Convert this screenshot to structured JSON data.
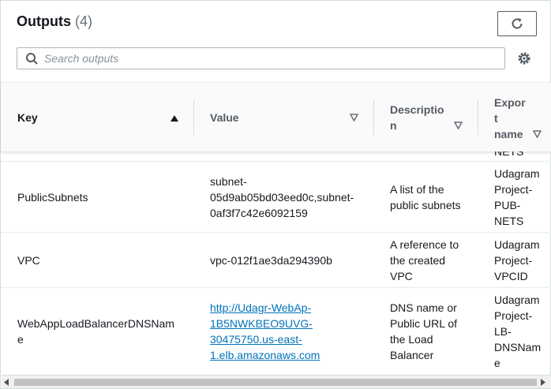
{
  "header": {
    "title": "Outputs",
    "count": "(4)"
  },
  "search": {
    "placeholder": "Search outputs"
  },
  "icons": {
    "refresh": "refresh-icon",
    "search": "search-icon",
    "settings": "gear-icon",
    "sort_asc": "caret-up-icon",
    "sort_desc": "caret-down-icon"
  },
  "colors": {
    "link": "#0073bb",
    "header_bg": "#fafafa",
    "border": "#eaeded"
  },
  "columns": [
    {
      "line1": "Key",
      "line2": "",
      "line3": ""
    },
    {
      "line1": "Value",
      "line2": "",
      "line3": ""
    },
    {
      "line1": "Descriptio",
      "line2": "n",
      "line3": ""
    },
    {
      "line1": "Expor",
      "line2": "t",
      "line3": "name"
    }
  ],
  "partial_row": {
    "export_tail": "NETS"
  },
  "rows": [
    {
      "key": "PublicSubnets",
      "value": [
        "subnet-",
        "05d9ab05bd03eed0c,subnet-",
        "0af3f7c42e6092159"
      ],
      "description": [
        "A list of the",
        "public subnets"
      ],
      "export": [
        "Udagram",
        "Project-",
        "PUB-",
        "NETS"
      ]
    },
    {
      "key": "VPC",
      "value": [
        "vpc-012f1ae3da294390b"
      ],
      "description": [
        "A reference to",
        "the created",
        "VPC"
      ],
      "export": [
        "Udagram",
        "Project-",
        "VPCID"
      ]
    },
    {
      "key": [
        "WebAppLoadBalancerDNSNam",
        "e"
      ],
      "value_link": [
        "http://Udagr-WebAp-",
        "1B5NWKBEO9UVG-",
        "30475750.us-east-",
        "1.elb.amazonaws.com"
      ],
      "description": [
        "DNS name or",
        "Public URL of",
        "the Load",
        "Balancer"
      ],
      "export": [
        "Udagram",
        "Project-",
        "LB-",
        "DNSNam",
        "e"
      ]
    }
  ]
}
